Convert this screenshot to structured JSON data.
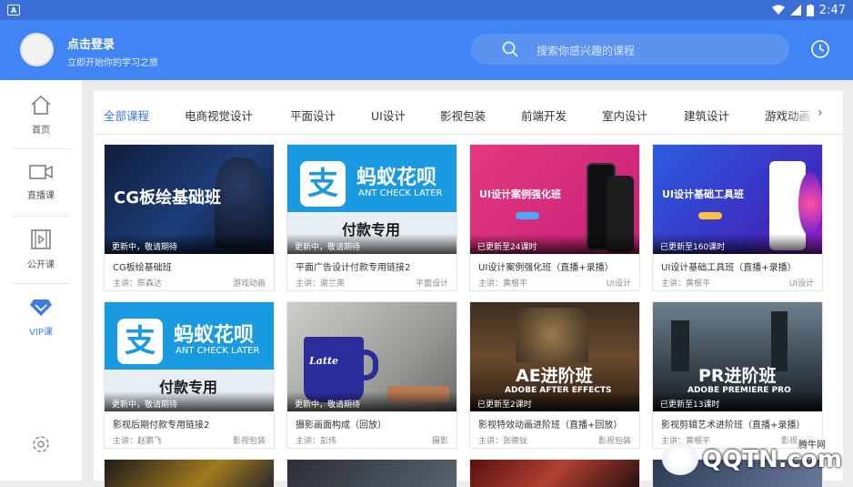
{
  "statusbar": {
    "app_badge": "A",
    "time": "2:47"
  },
  "header": {
    "login_title": "点击登录",
    "login_subtitle": "立即开始你的学习之旅",
    "search_placeholder": "搜索你感兴趣的课程"
  },
  "sidebar": {
    "items": [
      {
        "label": "首页",
        "icon": "home-icon"
      },
      {
        "label": "直播课",
        "icon": "video-camera-icon"
      },
      {
        "label": "公开课",
        "icon": "film-icon"
      },
      {
        "label": "VIP课",
        "icon": "diamond-icon"
      }
    ]
  },
  "tabs": [
    "全部课程",
    "电商视觉设计",
    "平面设计",
    "UI设计",
    "影视包装",
    "前端开发",
    "室内设计",
    "建筑设计",
    "游戏动画"
  ],
  "courses": [
    {
      "status": "更新中，敬请期待",
      "title": "CG板绘基础班",
      "teacher": "主讲：陈森达",
      "category": "游戏动画",
      "thumb_text": "CG板绘基础班"
    },
    {
      "status": "更新中，敬请期待",
      "title": "平面广告设计付款专用链接2",
      "teacher": "主讲：谢兰英",
      "category": "平面设计",
      "thumb_text": "蚂蚁花呗",
      "thumb_sub": "ANT CHECK LATER",
      "thumb_band": "付款专用"
    },
    {
      "status": "已更新至24课时",
      "title": "UI设计案例强化班（直播+录播）",
      "teacher": "主讲：黄根平",
      "category": "UI设计",
      "thumb_text": "UI设计案例强化班"
    },
    {
      "status": "已更新至160课时",
      "title": "UI设计基础工具班（直播+录播）",
      "teacher": "主讲：黄根平",
      "category": "UI设计",
      "thumb_text": "UI设计基础工具班"
    },
    {
      "status": "更新中，敬请期待",
      "title": "影视后期付款专用链接2",
      "teacher": "主讲：赵鹏飞",
      "category": "影视包装",
      "thumb_text": "蚂蚁花呗",
      "thumb_sub": "ANT CHECK LATER",
      "thumb_band": "付款专用"
    },
    {
      "status": "更新中，敬请期待",
      "title": "摄影画面构成（回放）",
      "teacher": "主讲：彭伟",
      "category": "摄影",
      "thumb_text": "Latte"
    },
    {
      "status": "已更新至2课时",
      "title": "影视特效动画进阶班（直播+回放）",
      "teacher": "主讲：张德钛",
      "category": "影视包装",
      "thumb_text": "AE进阶班",
      "thumb_sub": "ADOBE AFTER EFFECTS"
    },
    {
      "status": "已更新至13课时",
      "title": "影视剪辑艺术进阶班（直播+录播）",
      "teacher": "主讲：黄根平",
      "category": "影视包装",
      "thumb_text": "PR进阶班",
      "thumb_sub": "ADOBE PREMIERE PRO"
    }
  ],
  "watermark": {
    "brand": "QQTN.com",
    "tag": "腾牛网"
  },
  "colors": {
    "header": "#4184f3",
    "statusbar": "#3a6fd8",
    "accent": "#3b7ae8"
  }
}
